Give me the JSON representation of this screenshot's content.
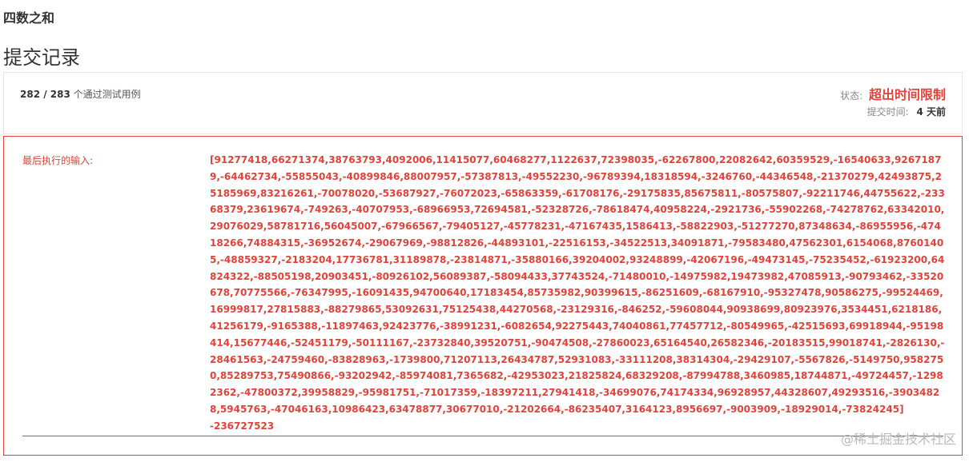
{
  "problem": {
    "title": "四数之和"
  },
  "page": {
    "title": "提交记录"
  },
  "result": {
    "passed": "282 / 283",
    "passed_suffix": "个通过测试用例",
    "status_label": "状态:",
    "status_value": "超出时间限制",
    "submitted_label": "提交时间:",
    "submitted_value": "4 天前",
    "status_color": "#e0433a"
  },
  "last_input": {
    "label": "最后执行的输入:",
    "nums": "[91277418,66271374,38763793,4092006,11415077,60468277,1122637,72398035,-62267800,22082642,60359529,-16540633,92671879,-64462734,-55855043,-40899846,88007957,-57387813,-49552230,-96789394,18318594,-3246760,-44346548,-21370279,42493875,25185969,83216261,-70078020,-53687927,-76072023,-65863359,-61708176,-29175835,85675811,-80575807,-92211746,44755622,-23368379,23619674,-749263,-40707953,-68966953,72694581,-52328726,-78618474,40958224,-2921736,-55902268,-74278762,63342010,29076029,58781716,56045007,-67966567,-79405127,-45778231,-47167435,1586413,-58822903,-51277270,87348634,-86955956,-47418266,74884315,-36952674,-29067969,-98812826,-44893101,-22516153,-34522513,34091871,-79583480,47562301,6154068,87601405,-48859327,-2183204,17736781,31189878,-23814871,-35880166,39204002,93248899,-42067196,-49473145,-75235452,-61923200,64824322,-88505198,20903451,-80926102,56089387,-58094433,37743524,-71480010,-14975982,19473982,47085913,-90793462,-33520678,70775566,-76347995,-16091435,94700640,17183454,85735982,90399615,-86251609,-68167910,-95327478,90586275,-99524469,16999817,27815883,-88279865,53092631,75125438,44270568,-23129316,-846252,-59608044,90938699,80923976,3534451,6218186,41256179,-9165388,-11897463,92423776,-38991231,-6082654,92275443,74040861,77457712,-80549965,-42515693,69918944,-95198414,15677446,-52451179,-50111167,-23732840,39520751,-90474508,-27860023,65164540,26582346,-20183515,99018741,-2826130,-28461563,-24759460,-83828963,-1739800,71207113,26434787,52931083,-33111208,38314304,-29429107,-5567826,-5149750,9582750,85289753,75490866,-93202942,-85974081,7365682,-42953023,21825824,68329208,-87994788,3460985,18744871,-49724457,-12982362,-47800372,39958829,-95981751,-71017359,-18397211,27941418,-34699076,74174334,96928957,44328607,49293516,-39034828,5945763,-47046163,10986423,63478877,30677010,-21202664,-86235407,3164123,8956697,-9003909,-18929014,-73824245]",
    "target": "-236727523"
  },
  "watermark": "@稀土掘金技术社区"
}
